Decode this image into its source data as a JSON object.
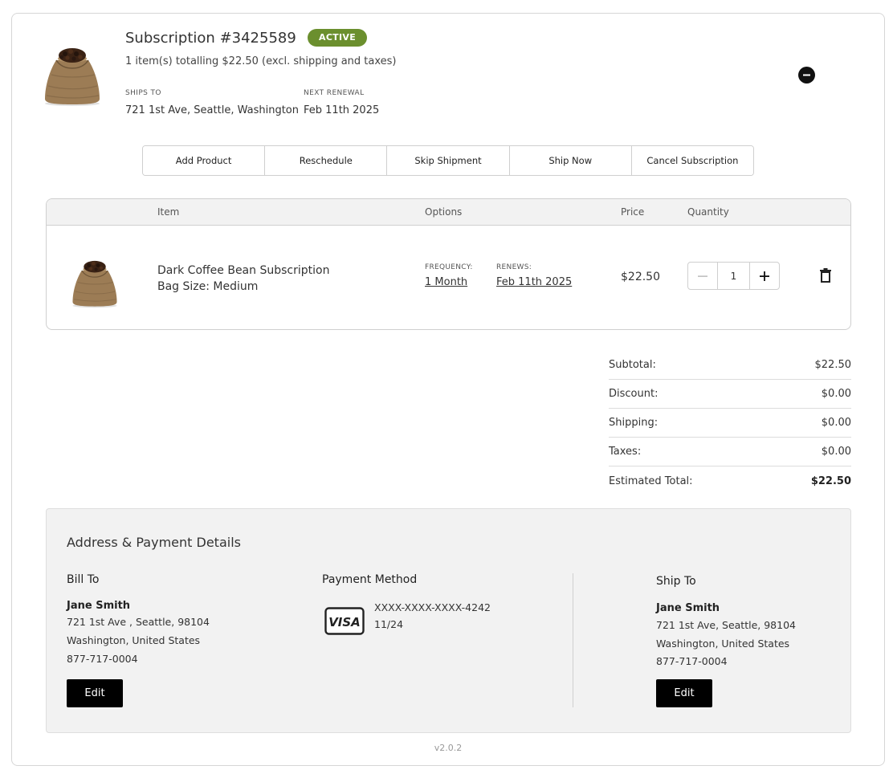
{
  "subscription": {
    "title": "Subscription #3425589",
    "status": "ACTIVE",
    "summary": "1 item(s) totalling $22.50 (excl. shipping and taxes)",
    "ships_to_label": "SHIPS TO",
    "ships_to": "721 1st Ave, Seattle, Washington",
    "next_renewal_label": "NEXT RENEWAL",
    "next_renewal": "Feb 11th 2025"
  },
  "actions": {
    "add_product": "Add Product",
    "reschedule": "Reschedule",
    "skip_shipment": "Skip Shipment",
    "ship_now": "Ship Now",
    "cancel_subscription": "Cancel Subscription"
  },
  "items_table": {
    "headers": {
      "item": "Item",
      "options": "Options",
      "price": "Price",
      "quantity": "Quantity"
    },
    "rows": [
      {
        "name": "Dark Coffee Bean Subscription",
        "variant": "Bag Size: Medium",
        "frequency_label": "FREQUENCY:",
        "frequency": "1 Month",
        "renews_label": "RENEWS:",
        "renews": "Feb 11th 2025",
        "price": "$22.50",
        "quantity": "1"
      }
    ]
  },
  "totals": [
    {
      "label": "Subtotal:",
      "value": "$22.50"
    },
    {
      "label": "Discount:",
      "value": "$0.00"
    },
    {
      "label": "Shipping:",
      "value": "$0.00"
    },
    {
      "label": "Taxes:",
      "value": "$0.00"
    },
    {
      "label": "Estimated Total:",
      "value": "$22.50"
    }
  ],
  "details": {
    "title": "Address & Payment Details",
    "bill_to": {
      "title": "Bill To",
      "name": "Jane Smith",
      "line1": "721 1st Ave , Seattle, 98104",
      "line2": "Washington, United States",
      "phone": "877-717-0004",
      "edit_label": "Edit"
    },
    "payment": {
      "title": "Payment Method",
      "card_brand_icon": "visa-icon",
      "card_brand_text": "VISA",
      "card_number": "XXXX-XXXX-XXXX-4242",
      "expiry": "11/24"
    },
    "ship_to": {
      "title": "Ship To",
      "name": "Jane Smith",
      "line1": "721 1st Ave, Seattle, 98104",
      "line2": "Washington, United States",
      "phone": "877-717-0004",
      "edit_label": "Edit"
    }
  },
  "version": "v2.0.2",
  "colors": {
    "active_badge": "#6b8f2e",
    "panel_bg": "#f2f2f2",
    "button_bg": "#000000"
  },
  "icons": {
    "product": "coffee-sack-icon",
    "collapse": "minus-circle-icon",
    "delete": "trash-icon",
    "decrement": "minus-icon",
    "increment": "plus-icon"
  }
}
